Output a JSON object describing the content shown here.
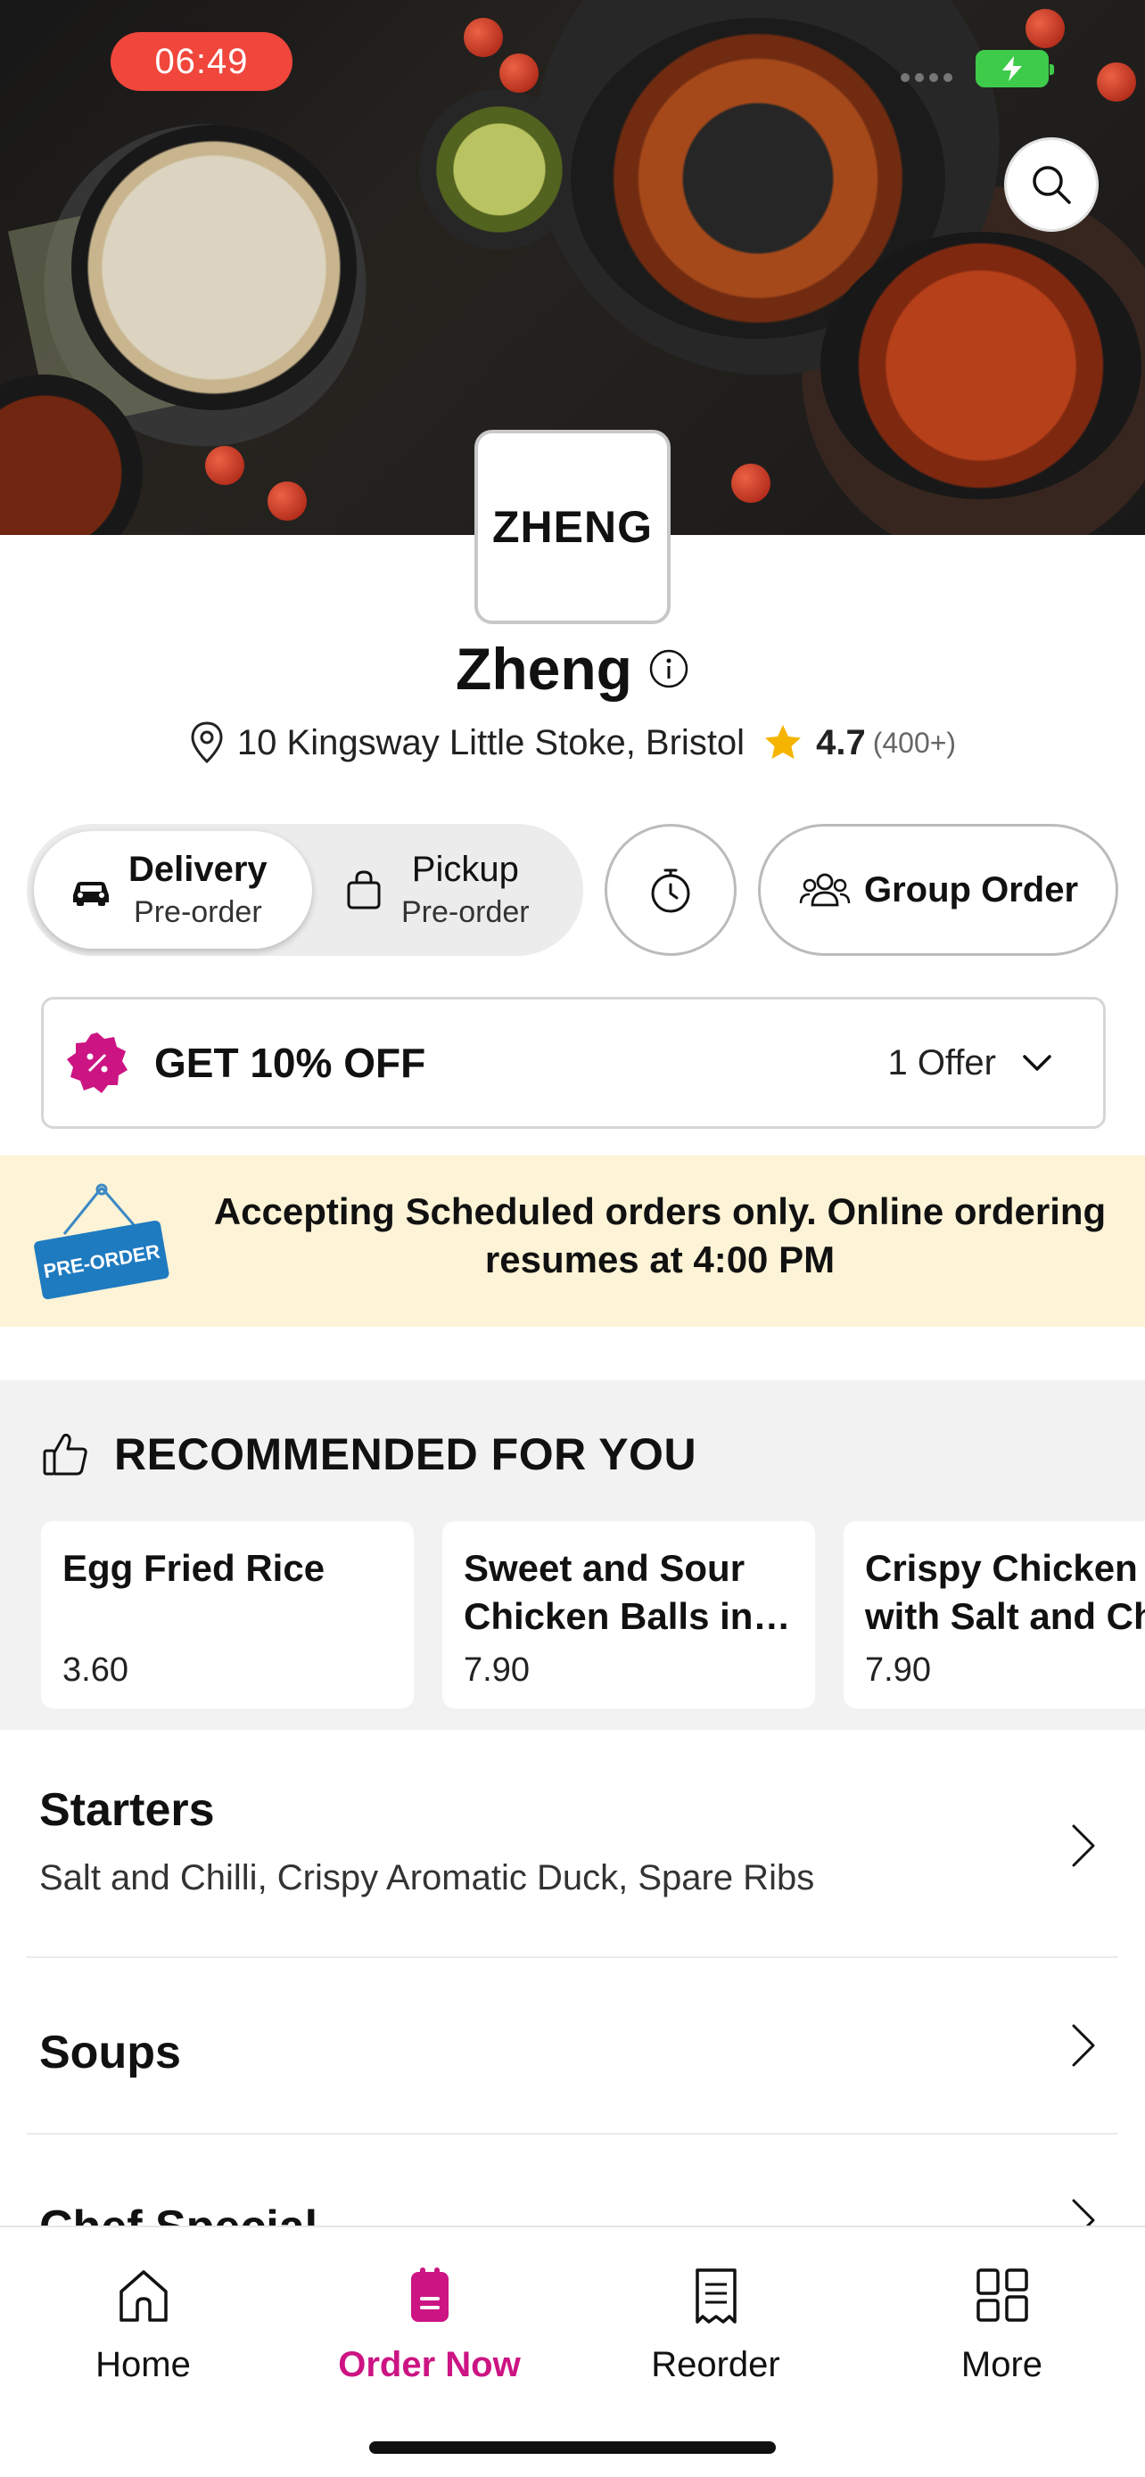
{
  "status_bar": {
    "time": "06:49"
  },
  "restaurant": {
    "logo_text": "ZHENG",
    "name": "Zheng",
    "address": "10 Kingsway Little Stoke, Bristol",
    "rating": "4.7",
    "rating_count": "(400+)"
  },
  "order_mode": {
    "delivery": {
      "label": "Delivery",
      "sub": "Pre-order",
      "selected": true
    },
    "pickup": {
      "label": "Pickup",
      "sub": "Pre-order",
      "selected": false
    },
    "group_order_label": "Group Order"
  },
  "offer": {
    "title": "GET 10% OFF",
    "count_label": "1 Offer"
  },
  "banner": {
    "sign_text": "PRE-ORDER",
    "message": "Accepting Scheduled orders only. Online ordering resumes at 4:00 PM"
  },
  "recommended": {
    "heading": "RECOMMENDED FOR YOU",
    "items": [
      {
        "line1": "Egg Fried Rice",
        "line2": "",
        "price": "3.60"
      },
      {
        "line1": "Sweet and Sour",
        "line2": "Chicken Balls in…",
        "price": "7.90"
      },
      {
        "line1": "Crispy Chicken",
        "line2": "with Salt and Ch",
        "price": "7.90"
      }
    ]
  },
  "categories": [
    {
      "title": "Starters",
      "subtitle": "Salt and Chilli, Crispy Aromatic Duck, Spare Ribs"
    },
    {
      "title": "Soups",
      "subtitle": ""
    },
    {
      "title": "Chef Special",
      "subtitle": ""
    }
  ],
  "tabbar": {
    "items": [
      {
        "label": "Home",
        "icon": "home-icon",
        "active": false
      },
      {
        "label": "Order Now",
        "icon": "order-icon",
        "active": true
      },
      {
        "label": "Reorder",
        "icon": "receipt-icon",
        "active": false
      },
      {
        "label": "More",
        "icon": "grid-icon",
        "active": false
      }
    ]
  },
  "colors": {
    "accent": "#cc1483",
    "banner_bg": "#fdf3d6",
    "star": "#f5b400",
    "time_pill": "#f0463c"
  }
}
